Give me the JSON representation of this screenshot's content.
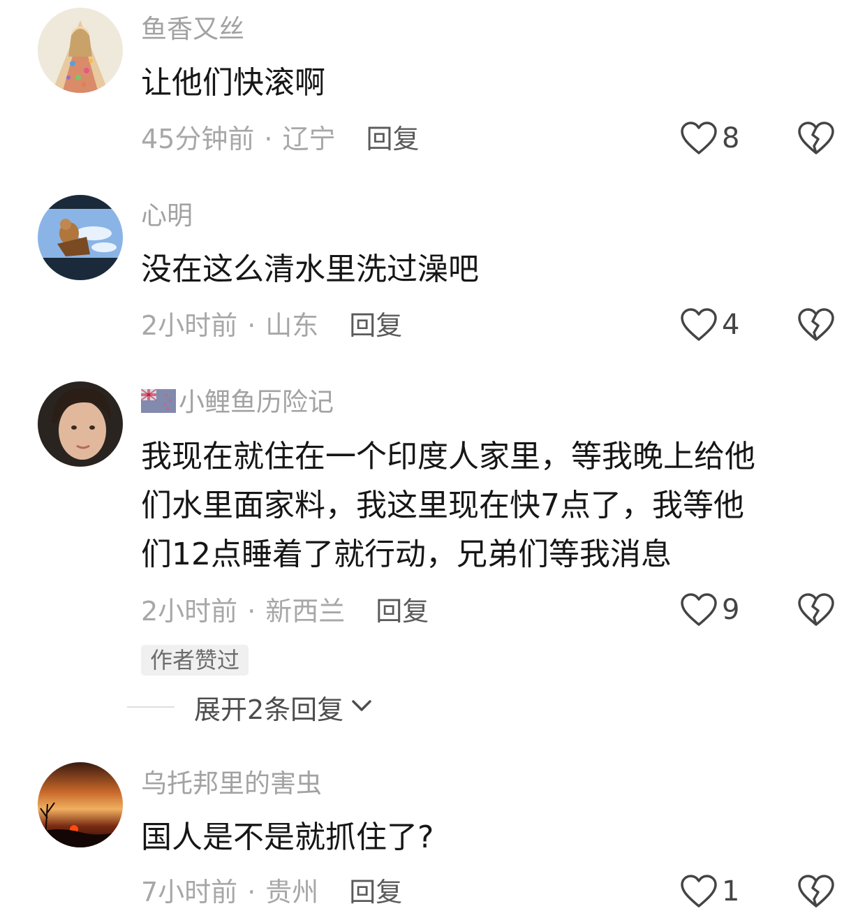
{
  "comments": [
    {
      "username": "鱼香又丝",
      "text": "让他们快滚啊",
      "time": "45分钟前",
      "location": "辽宁",
      "reply_label": "回复",
      "likes": "8"
    },
    {
      "username": "心明",
      "text": "没在这么清水里洗过澡吧",
      "time": "2小时前",
      "location": "山东",
      "reply_label": "回复",
      "likes": "4"
    },
    {
      "username": "小鲤鱼历险记",
      "flag_icon": "new-zealand-flag-icon",
      "text_lines": [
        "我现在就住在一个印度人家里，等我晚上给他",
        "们水里面家料，我这里现在快7点了，我等他",
        "们12点睡着了就行动，兄弟们等我消息"
      ],
      "time": "2小时前",
      "location": "新西兰",
      "reply_label": "回复",
      "likes": "9",
      "badge": "作者赞过",
      "expand_label": "展开2条回复"
    },
    {
      "username": "乌托邦里的害虫",
      "text": "国人是不是就抓住了?",
      "time": "7小时前",
      "location": "贵州",
      "reply_label": "回复",
      "likes": "1"
    }
  ],
  "colors": {
    "username": "#a2a2a2",
    "text": "#161616",
    "meta": "#a7a7a7",
    "reply": "#5a5a5a",
    "icon": "#444444",
    "badge_bg": "#f0f0f0"
  },
  "icons": {
    "like": "heart-outline-icon",
    "dislike": "broken-heart-icon",
    "expand": "chevron-down-icon"
  }
}
